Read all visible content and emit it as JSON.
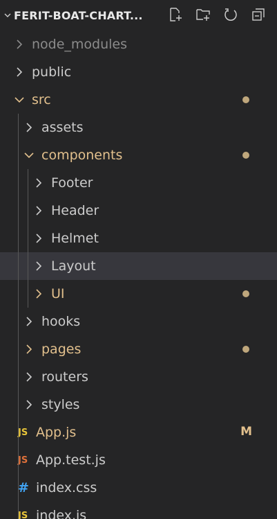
{
  "explorer": {
    "title": "FERIT-BOAT-CHART...",
    "actions": [
      {
        "name": "new-file"
      },
      {
        "name": "new-folder"
      },
      {
        "name": "refresh"
      },
      {
        "name": "collapse-all"
      }
    ]
  },
  "tree": {
    "node_modules": "node_modules",
    "public": "public",
    "src": "src",
    "assets": "assets",
    "components": "components",
    "footer": "Footer",
    "header": "Header",
    "helmet": "Helmet",
    "layout": "Layout",
    "ui": "UI",
    "hooks": "hooks",
    "pages": "pages",
    "routers": "routers",
    "styles": "styles",
    "app_js": "App.js",
    "app_js_badge": "M",
    "app_test_js": "App.test.js",
    "index_css": "index.css",
    "index_js": "index.js",
    "icon_js": "JS",
    "icon_css": "#"
  },
  "colors": {
    "background": "#252526",
    "selected": "#37373d",
    "modified": "#e2c08d",
    "js_icon": "#e8c53a",
    "css_icon": "#42a5f5"
  }
}
